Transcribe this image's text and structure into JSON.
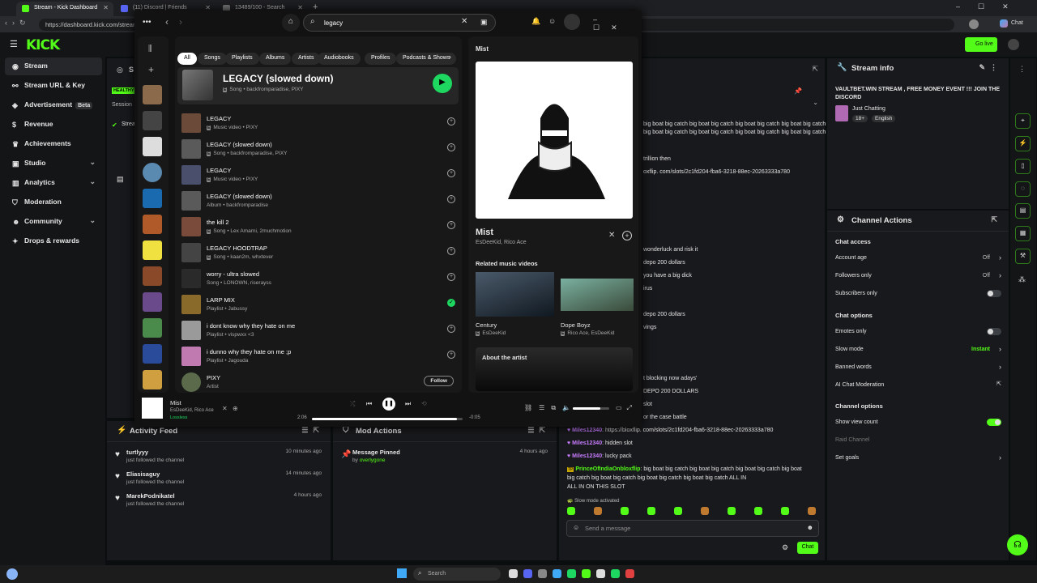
{
  "browser": {
    "tabs": [
      {
        "title": "Stream - Kick Dashboard",
        "active": true,
        "color": "#53fc18"
      },
      {
        "title": "(11) Discord | Friends",
        "active": false,
        "color": "#5865f2"
      },
      {
        "title": "13489/100 - Search",
        "active": false,
        "color": "#777777"
      }
    ],
    "url": "https://dashboard.kick.com/stream",
    "chat_label": "Chat"
  },
  "kick": {
    "logo": "KICK",
    "go_live": "Go live",
    "sidebar": [
      {
        "label": "Stream",
        "icon": "broadcast-icon",
        "glyph": "◉",
        "active": true
      },
      {
        "label": "Stream URL & Key",
        "icon": "link-icon",
        "glyph": "⚯"
      },
      {
        "label": "Advertisement",
        "icon": "megaphone-icon",
        "glyph": "◈",
        "badge": "Beta"
      },
      {
        "label": "Revenue",
        "icon": "dollar-icon",
        "glyph": "$"
      },
      {
        "label": "Achievements",
        "icon": "trophy-icon",
        "glyph": "♛"
      },
      {
        "label": "Studio",
        "icon": "camera-icon",
        "glyph": "▣",
        "chevron": true
      },
      {
        "label": "Analytics",
        "icon": "chart-icon",
        "glyph": "▥",
        "chevron": true
      },
      {
        "label": "Moderation",
        "icon": "shield-icon",
        "glyph": "⛉"
      },
      {
        "label": "Community",
        "icon": "people-icon",
        "glyph": "☻",
        "chevron": true
      },
      {
        "label": "Drops & rewards",
        "icon": "gift-icon",
        "glyph": "✦"
      }
    ],
    "stream_panel": {
      "title": "S",
      "health": "HEALTHY",
      "session": "Session",
      "stream_status": "Strea"
    },
    "activity_feed": {
      "title": "Activity Feed",
      "items": [
        {
          "name": "turtlyyy",
          "sub": "just followed the channel",
          "time": "10 minutes ago"
        },
        {
          "name": "Eliasisaguy",
          "sub": "just followed the channel",
          "time": "14 minutes ago"
        },
        {
          "name": "MarekPodnikatel",
          "sub": "just followed the channel",
          "time": "4 hours ago"
        }
      ]
    },
    "mod_actions": {
      "title": "Mod Actions",
      "items": [
        {
          "name": "Message Pinned",
          "by_prefix": "by",
          "by": "overlygone",
          "time": "4 hours ago"
        }
      ]
    },
    "chat": {
      "partial_lines": [
        "big boat big catch big boat big catch big boat big catch big boat big catch big boat",
        "big boat big catch big boat big catch big boat big catch big boat big catch",
        "trillion then",
        "oxflip. com/slots/2c1fd204-fba6-3218-88ec-20263333a780",
        "wonderluck and risk it",
        "depo 200 dollars",
        "you have a big dick",
        "irus",
        "depo 200 dollars",
        "vings",
        "t blocking now adays'",
        "DEPO 200 DOLLARS",
        "slot",
        "or the case battle"
      ],
      "messages": [
        {
          "user": "Miles12340",
          "text": "https://bloxflip. com/slots/2c1fd204-fba6-3218-88ec-20263333a780"
        },
        {
          "user": "Miles12340",
          "text": "hidden slot"
        },
        {
          "user": "Miles12340",
          "text": "lucky pack"
        }
      ],
      "long_message": {
        "user": "PrinceOfIndiaOnbloxflip",
        "lines": [
          ": big boat big catch big boat big catch big boat big catch big boat",
          "big catch big boat big catch big boat big catch big boat big catch ALL IN",
          "ALL IN ON THIS SLOT"
        ]
      },
      "slow_mode": "Slow mode activated",
      "placeholder": "Send a message",
      "send": "Chat"
    },
    "stream_info": {
      "title": "Stream info",
      "stream_title": "VAULTBET.WIN STREAM , FREE MONEY EVENT !!! JOIN THE DISCORD",
      "category": "Just Chatting",
      "tags": [
        "18+",
        "English"
      ]
    },
    "channel_actions": {
      "title": "Channel Actions",
      "chat_access": "Chat access",
      "rows1": [
        {
          "label": "Account age",
          "value": "Off",
          "type": "chevron"
        },
        {
          "label": "Followers only",
          "value": "Off",
          "type": "chevron"
        },
        {
          "label": "Subscribers only",
          "type": "toggle",
          "on": false
        }
      ],
      "chat_options": "Chat options",
      "rows2": [
        {
          "label": "Emotes only",
          "type": "toggle",
          "on": false
        },
        {
          "label": "Slow mode",
          "value": "Instant",
          "type": "chevron",
          "green": true
        },
        {
          "label": "Banned words",
          "type": "chevron"
        },
        {
          "label": "AI Chat Moderation",
          "type": "external"
        }
      ],
      "channel_options": "Channel options",
      "rows3": [
        {
          "label": "Show view count",
          "type": "toggle",
          "on": true
        },
        {
          "label": "Raid Channel",
          "type": "none",
          "dim": true
        },
        {
          "label": "Set goals",
          "type": "chevron"
        }
      ]
    }
  },
  "spotify": {
    "search_value": "legacy",
    "chips": [
      "All",
      "Songs",
      "Playlists",
      "Albums",
      "Artists",
      "Audiobooks",
      "Profiles",
      "Podcasts & Shows"
    ],
    "top_result": {
      "title": "LEGACY (slowed down)",
      "type": "Song",
      "artists": "backfromparadise, PIXY"
    },
    "results": [
      {
        "title": "LEGACY",
        "sub": "Music video • PIXY",
        "explicit": true,
        "art": "#6b4a3a"
      },
      {
        "title": "LEGACY (slowed down)",
        "sub": "Song • backfromparadise, PIXY",
        "explicit": true,
        "art": "#5a5a5a"
      },
      {
        "title": "LEGACY",
        "sub": "Music video • PIXY",
        "explicit": true,
        "art": "#4a4f6b"
      },
      {
        "title": "LEGACY (slowed down)",
        "sub": "Album • backfromparadise",
        "explicit": false,
        "art": "#5a5a5a"
      },
      {
        "title": "the kill 2",
        "sub": "Song • Lex Amarni, 2muchmotion",
        "explicit": true,
        "art": "#7a4a3a"
      },
      {
        "title": "LEGACY HOODTRAP",
        "sub": "Song • kaan2m, whxtever",
        "explicit": true,
        "art": "#444444"
      },
      {
        "title": "worry - ultra slowed",
        "sub": "Song • LONOWN, riserayss",
        "explicit": false,
        "art": "#2a2a2a"
      },
      {
        "title": "LARP MIX",
        "sub": "Playlist • Jabussy",
        "explicit": false,
        "art": "#8a6a2a",
        "saved": true
      },
      {
        "title": "i dont know why they hate on me",
        "sub": "Playlist • vispwxx <3",
        "explicit": false,
        "art": "#9a9a9a"
      },
      {
        "title": "i dunno why they hate on me ;p",
        "sub": "Playlist • Jagouda",
        "explicit": false,
        "art": "#c07ab0"
      },
      {
        "title": "PIXY",
        "sub": "Artist",
        "explicit": false,
        "art": "#5a6a4a",
        "follow": "Follow"
      }
    ],
    "right_panel": {
      "header": "Mist",
      "track_title": "Mist",
      "track_artists": "EsDeeKid, Rico Ace",
      "related_heading": "Related music videos",
      "videos": [
        {
          "title": "Century",
          "artist": "EsDeeKid"
        },
        {
          "title": "Dope Boyz",
          "artist": "Rico Ace, EsDeeKid"
        }
      ],
      "about": "About the artist"
    },
    "now_playing": {
      "title": "Mist",
      "artists": "EsDeeKid, Rico Ace",
      "quality": "Lossless",
      "elapsed": "2:06",
      "remaining": "-0:05",
      "progress": 0.96,
      "volume": 0.75
    }
  },
  "taskbar": {
    "search_placeholder": "Search"
  }
}
